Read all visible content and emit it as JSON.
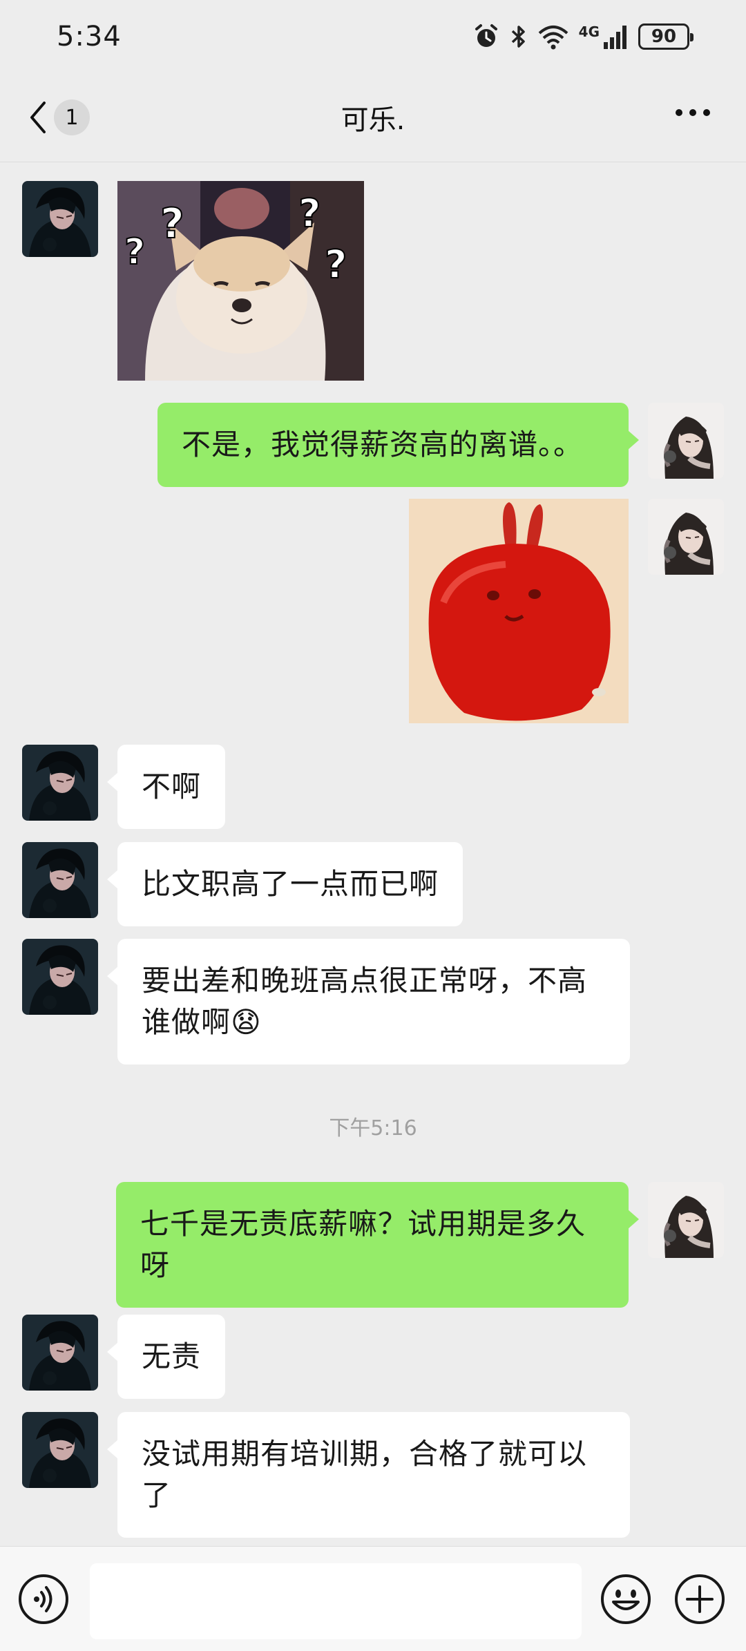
{
  "status_bar": {
    "time": "5:34",
    "network": "4G",
    "battery": "90",
    "icons": [
      "alarm-icon",
      "bluetooth-icon",
      "wifi-icon",
      "signal-icon",
      "battery-icon"
    ]
  },
  "header": {
    "back_icon": "chevron-left-icon",
    "unread_count": "1",
    "title": "可乐.",
    "more_icon": "more-horizontal-icon"
  },
  "messages": [
    {
      "side": "left",
      "type": "sticker",
      "sticker": "confused-dog-question-marks"
    },
    {
      "side": "right",
      "type": "text",
      "text": "不是，我觉得薪资高的离谱。。"
    },
    {
      "side": "right",
      "type": "sticker",
      "sticker": "red-bunny"
    },
    {
      "side": "left",
      "type": "text",
      "text": "不啊"
    },
    {
      "side": "left",
      "type": "text",
      "text": "比文职高了一点而已啊"
    },
    {
      "side": "left",
      "type": "text",
      "text": "要出差和晚班高点很正常呀，不高谁做啊😧"
    },
    {
      "side": "right",
      "type": "text",
      "text": "七千是无责底薪嘛？试用期是多久呀"
    },
    {
      "side": "left",
      "type": "text",
      "text": "无责"
    },
    {
      "side": "left",
      "type": "text",
      "text": "没试用期有培训期，合格了就可以了"
    }
  ],
  "timestamp": "下午5:16",
  "input_bar": {
    "voice_icon": "voice-icon",
    "input_value": "",
    "emoji_icon": "emoji-icon",
    "plus_icon": "plus-icon"
  },
  "colors": {
    "background": "#ededed",
    "sent_bubble": "#95ec69",
    "received_bubble": "#ffffff"
  }
}
